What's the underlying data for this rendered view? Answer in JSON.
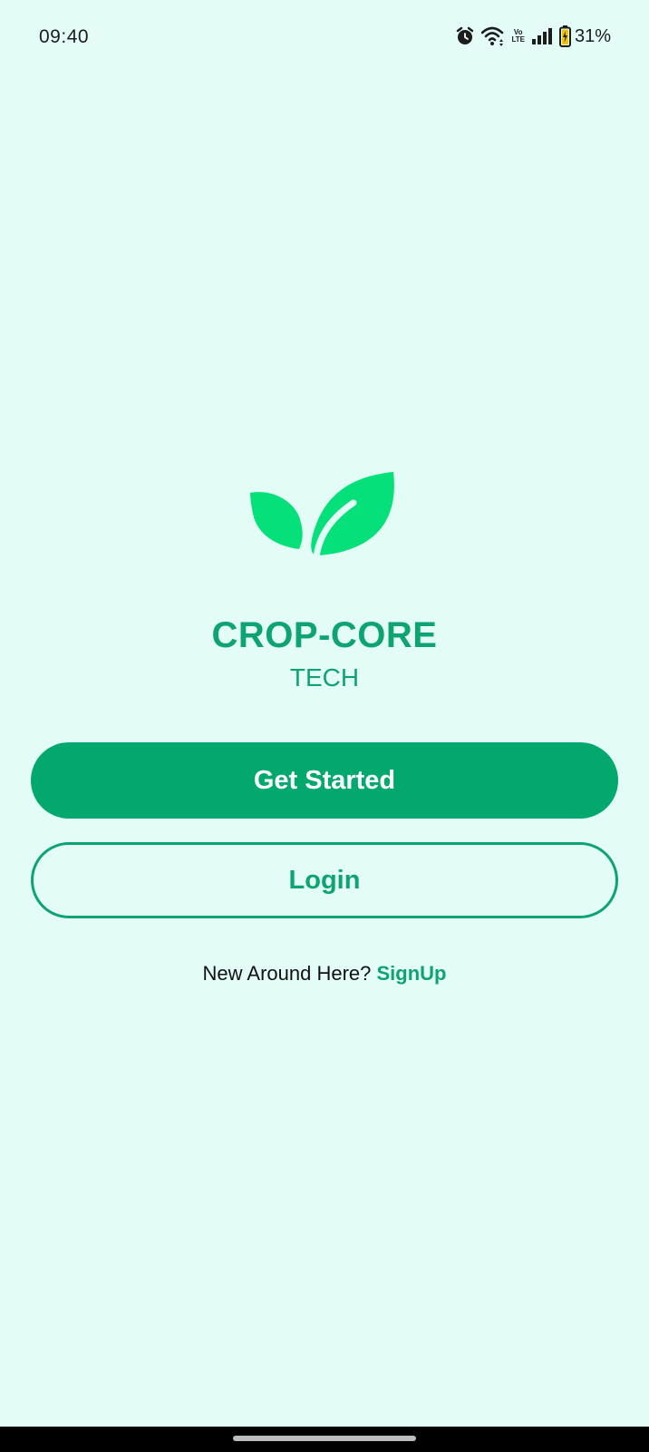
{
  "status_bar": {
    "time": "09:40",
    "volte_top": "Vo",
    "volte_bottom": "LTE",
    "battery_percent": "31%",
    "icons": [
      "alarm-icon",
      "wifi-icon",
      "volte-icon",
      "signal-icon",
      "battery-charging-icon"
    ]
  },
  "brand": {
    "logo_icon": "leaf-icon",
    "title": "CROP-CORE",
    "subtitle": "TECH"
  },
  "actions": {
    "get_started_label": "Get Started",
    "login_label": "Login"
  },
  "signup": {
    "prompt": "New Around Here?",
    "link_label": "SignUp"
  },
  "colors": {
    "background": "#e3fcf6",
    "primary": "#02a86d",
    "accent_text": "#0ea472",
    "leaf": "#05e07a"
  }
}
